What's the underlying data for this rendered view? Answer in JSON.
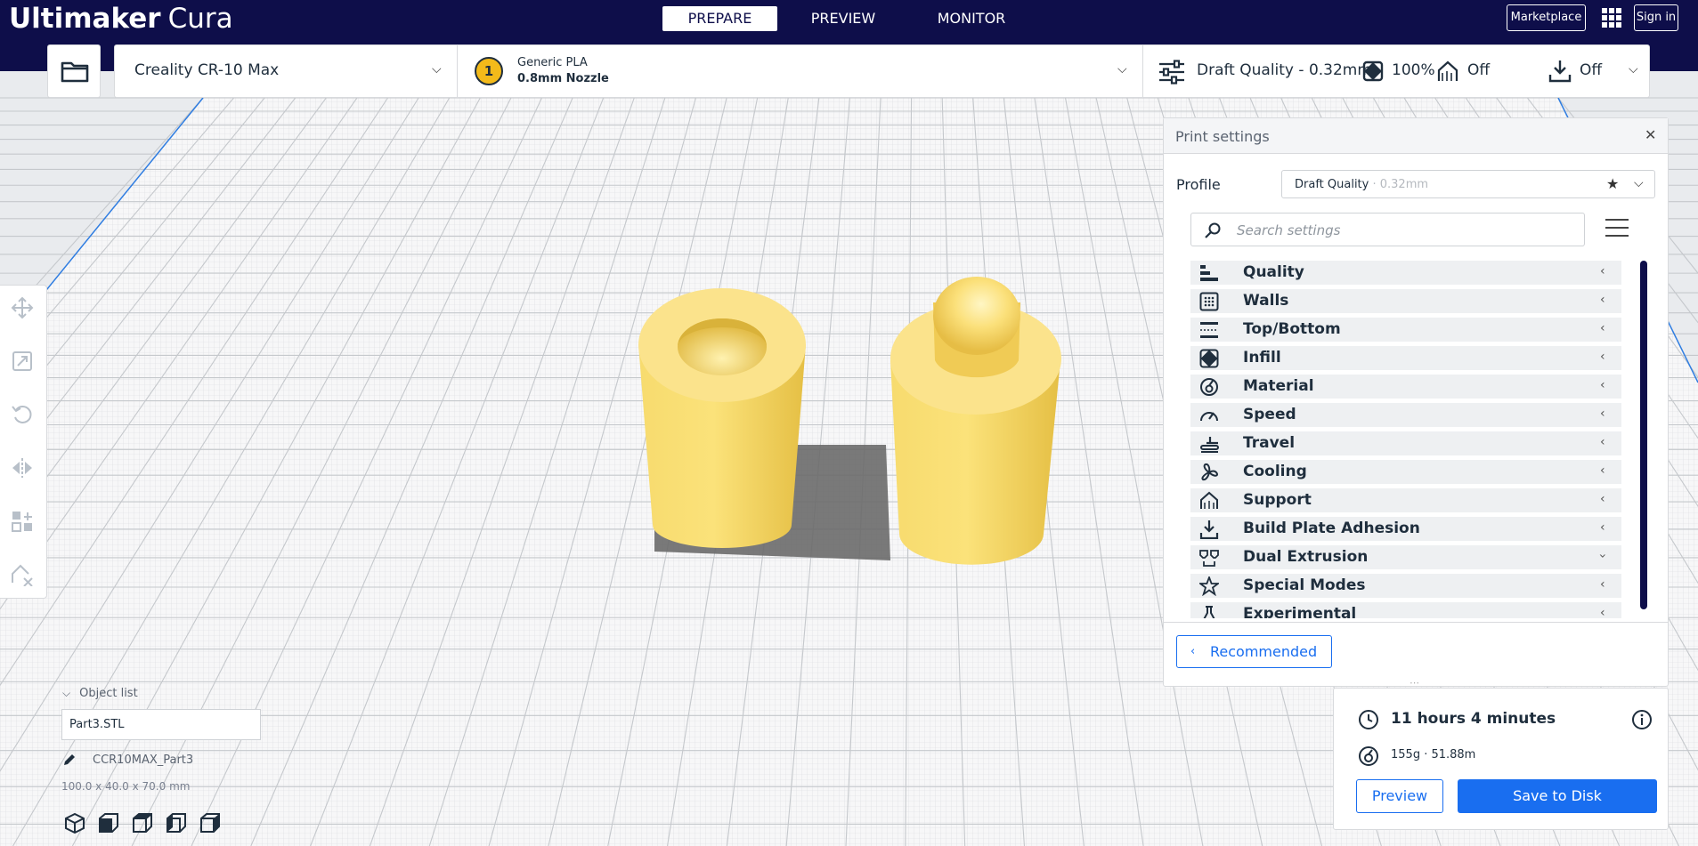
{
  "app": {
    "brand_bold": "Ultimaker",
    "brand_light": "Cura"
  },
  "stages": [
    {
      "label": "PREPARE",
      "active": true
    },
    {
      "label": "PREVIEW",
      "active": false
    },
    {
      "label": "MONITOR",
      "active": false
    }
  ],
  "header": {
    "marketplace": "Marketplace",
    "signin": "Sign in",
    "apps_icon": "apps-grid-icon"
  },
  "toolbar": {
    "open_icon": "folder-icon",
    "machine": "Creality CR-10 Max",
    "extruder_number": "1",
    "material": "Generic PLA",
    "nozzle": "0.8mm Nozzle",
    "quality": "Draft Quality - 0.32mm",
    "infill": "100%",
    "support": "Off",
    "adhesion": "Off"
  },
  "tools": [
    "move-icon",
    "scale-icon",
    "rotate-icon",
    "mirror-icon",
    "per-model-settings-icon",
    "support-blocker-icon"
  ],
  "print_settings": {
    "title": "Print settings",
    "profile_label": "Profile",
    "profile_name": "Draft Quality",
    "profile_sub": " · 0.32mm",
    "search_placeholder": "Search settings",
    "categories": [
      {
        "label": "Quality",
        "icon": "quality-icon",
        "expanded": false
      },
      {
        "label": "Walls",
        "icon": "walls-icon",
        "expanded": false
      },
      {
        "label": "Top/Bottom",
        "icon": "top-bottom-icon",
        "expanded": false
      },
      {
        "label": "Infill",
        "icon": "infill-icon",
        "expanded": false
      },
      {
        "label": "Material",
        "icon": "material-icon",
        "expanded": false
      },
      {
        "label": "Speed",
        "icon": "speed-icon",
        "expanded": false
      },
      {
        "label": "Travel",
        "icon": "travel-icon",
        "expanded": false
      },
      {
        "label": "Cooling",
        "icon": "cooling-fan-icon",
        "expanded": false
      },
      {
        "label": "Support",
        "icon": "support-icon",
        "expanded": false
      },
      {
        "label": "Build Plate Adhesion",
        "icon": "adhesion-icon",
        "expanded": false
      },
      {
        "label": "Dual Extrusion",
        "icon": "dual-extrusion-icon",
        "expanded": true
      },
      {
        "label": "Special Modes",
        "icon": "special-modes-star-icon",
        "expanded": false
      },
      {
        "label": "Experimental",
        "icon": "experimental-flask-icon",
        "expanded": false
      }
    ],
    "recommended_label": "Recommended"
  },
  "print_info": {
    "time": "11 hours 4 minutes",
    "material_usage": "155g · 51.88m",
    "preview_label": "Preview",
    "save_label": "Save to Disk"
  },
  "object_list": {
    "toggle_label": "Object list",
    "items": [
      "Part3.STL"
    ],
    "job_name": "CCR10MAX_Part3",
    "dimensions": "100.0 x 40.0 x 70.0 mm"
  },
  "colors": {
    "header": "#0e0e4a",
    "accent": "#196ef0",
    "model": "#f7d558"
  }
}
